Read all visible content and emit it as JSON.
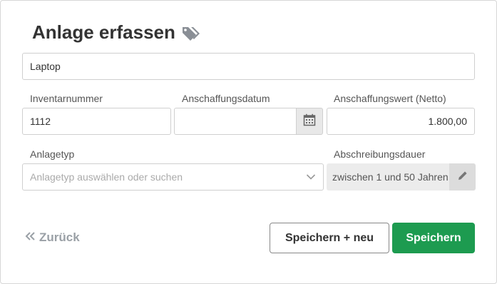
{
  "title": "Anlage erfassen",
  "icons": {
    "title_icon": "tags-icon",
    "calendar": "calendar-icon",
    "dropdown": "chevron-down-icon",
    "edit": "pencil-icon",
    "back": "double-chevron-left-icon"
  },
  "fields": {
    "name": {
      "value": "Laptop"
    },
    "inventory_number": {
      "label": "Inventarnummer",
      "value": "1112"
    },
    "acquisition_date": {
      "label": "Anschaffungsdatum",
      "value": ""
    },
    "acquisition_value": {
      "label": "Anschaffungswert (Netto)",
      "value": "1.800,00"
    },
    "asset_type": {
      "label": "Anlagetyp",
      "placeholder": "Anlagetyp auswählen oder suchen"
    },
    "depreciation_period": {
      "label": "Abschreibungsdauer",
      "value": "zwischen 1 und 50 Jahren"
    }
  },
  "actions": {
    "back": "Zurück",
    "save_new": "Speichern + neu",
    "save": "Speichern"
  },
  "colors": {
    "primary": "#1d9b50",
    "title_icon": "#8a8f96",
    "muted": "#9aa0a6"
  }
}
